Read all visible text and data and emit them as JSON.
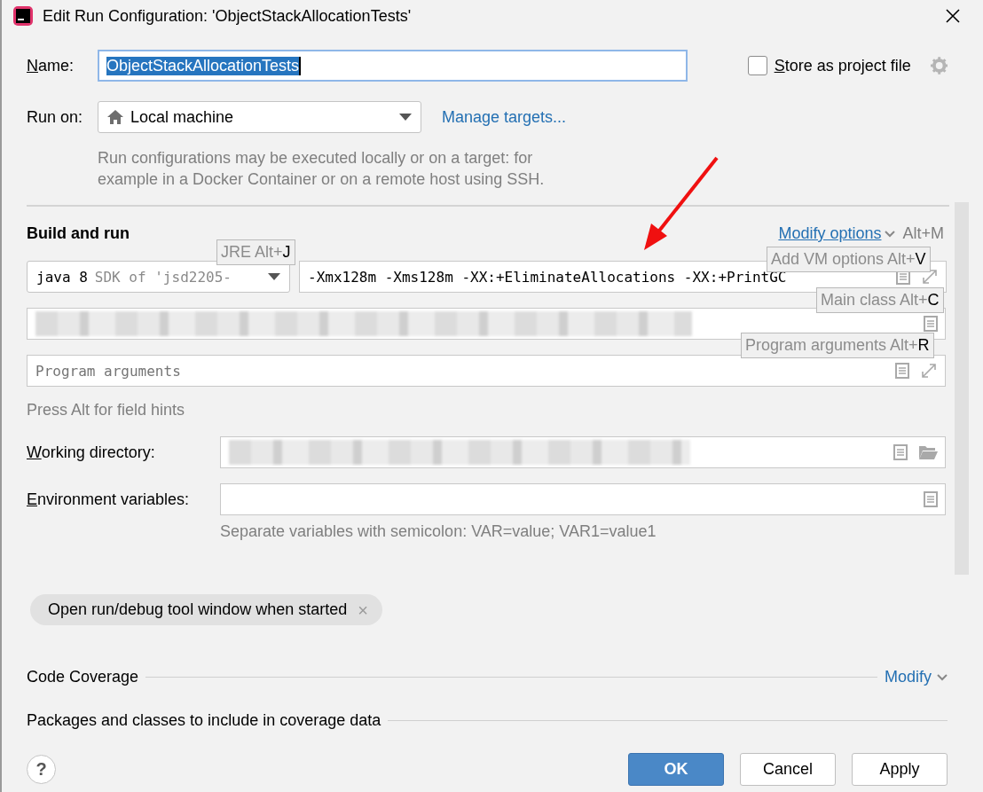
{
  "window": {
    "title": "Edit Run Configuration: 'ObjectStackAllocationTests'"
  },
  "name": {
    "label": "Name:",
    "mnemonic_underlined": true,
    "value": "ObjectStackAllocationTests",
    "text_selected": true
  },
  "store_as_project_file": {
    "label": "Store as project file",
    "mnemonic_underlined": true,
    "checked": false
  },
  "run_on": {
    "label": "Run on:",
    "value": "Local machine",
    "link": "Manage targets..."
  },
  "run_on_description": [
    "Run configurations may be executed locally or on a target: for",
    "example in a Docker Container or on a remote host using SSH."
  ],
  "build_and_run": {
    "title": "Build and run",
    "modify_link": "Modify options",
    "modify_shortcut": "Alt+M",
    "jre": {
      "value": "java 8",
      "detail": "SDK of 'jsd2205-"
    },
    "vm_options": {
      "value": "-Xmx128m -Xms128m -XX:+EliminateAllocations -XX:+PrintGC"
    },
    "program_arguments": {
      "placeholder": "Program arguments"
    },
    "hints": [
      {
        "label": "JRE Alt+",
        "key": "J"
      },
      {
        "label": "Add VM options Alt+",
        "key": "V"
      },
      {
        "label": "Main class Alt+",
        "key": "C"
      },
      {
        "label": "Program arguments Alt+",
        "key": "R"
      }
    ],
    "press_alt_hint": "Press Alt for field hints"
  },
  "working_directory": {
    "label": "Working directory:",
    "mnemonic_underlined": true
  },
  "environment_variables": {
    "label": "Environment variables:",
    "mnemonic_underlined": true,
    "hint": "Separate variables with semicolon: VAR=value; VAR1=value1"
  },
  "option_chips": [
    {
      "label": "Open run/debug tool window when started",
      "close": "×"
    }
  ],
  "code_coverage": {
    "title": "Code Coverage",
    "modify_link": "Modify",
    "packages_title": "Packages and classes to include in coverage data"
  },
  "buttons": [
    {
      "label": "OK",
      "kind": "primary"
    },
    {
      "label": "Cancel",
      "kind": "default"
    },
    {
      "label": "Apply",
      "kind": "default"
    }
  ],
  "help": "?"
}
